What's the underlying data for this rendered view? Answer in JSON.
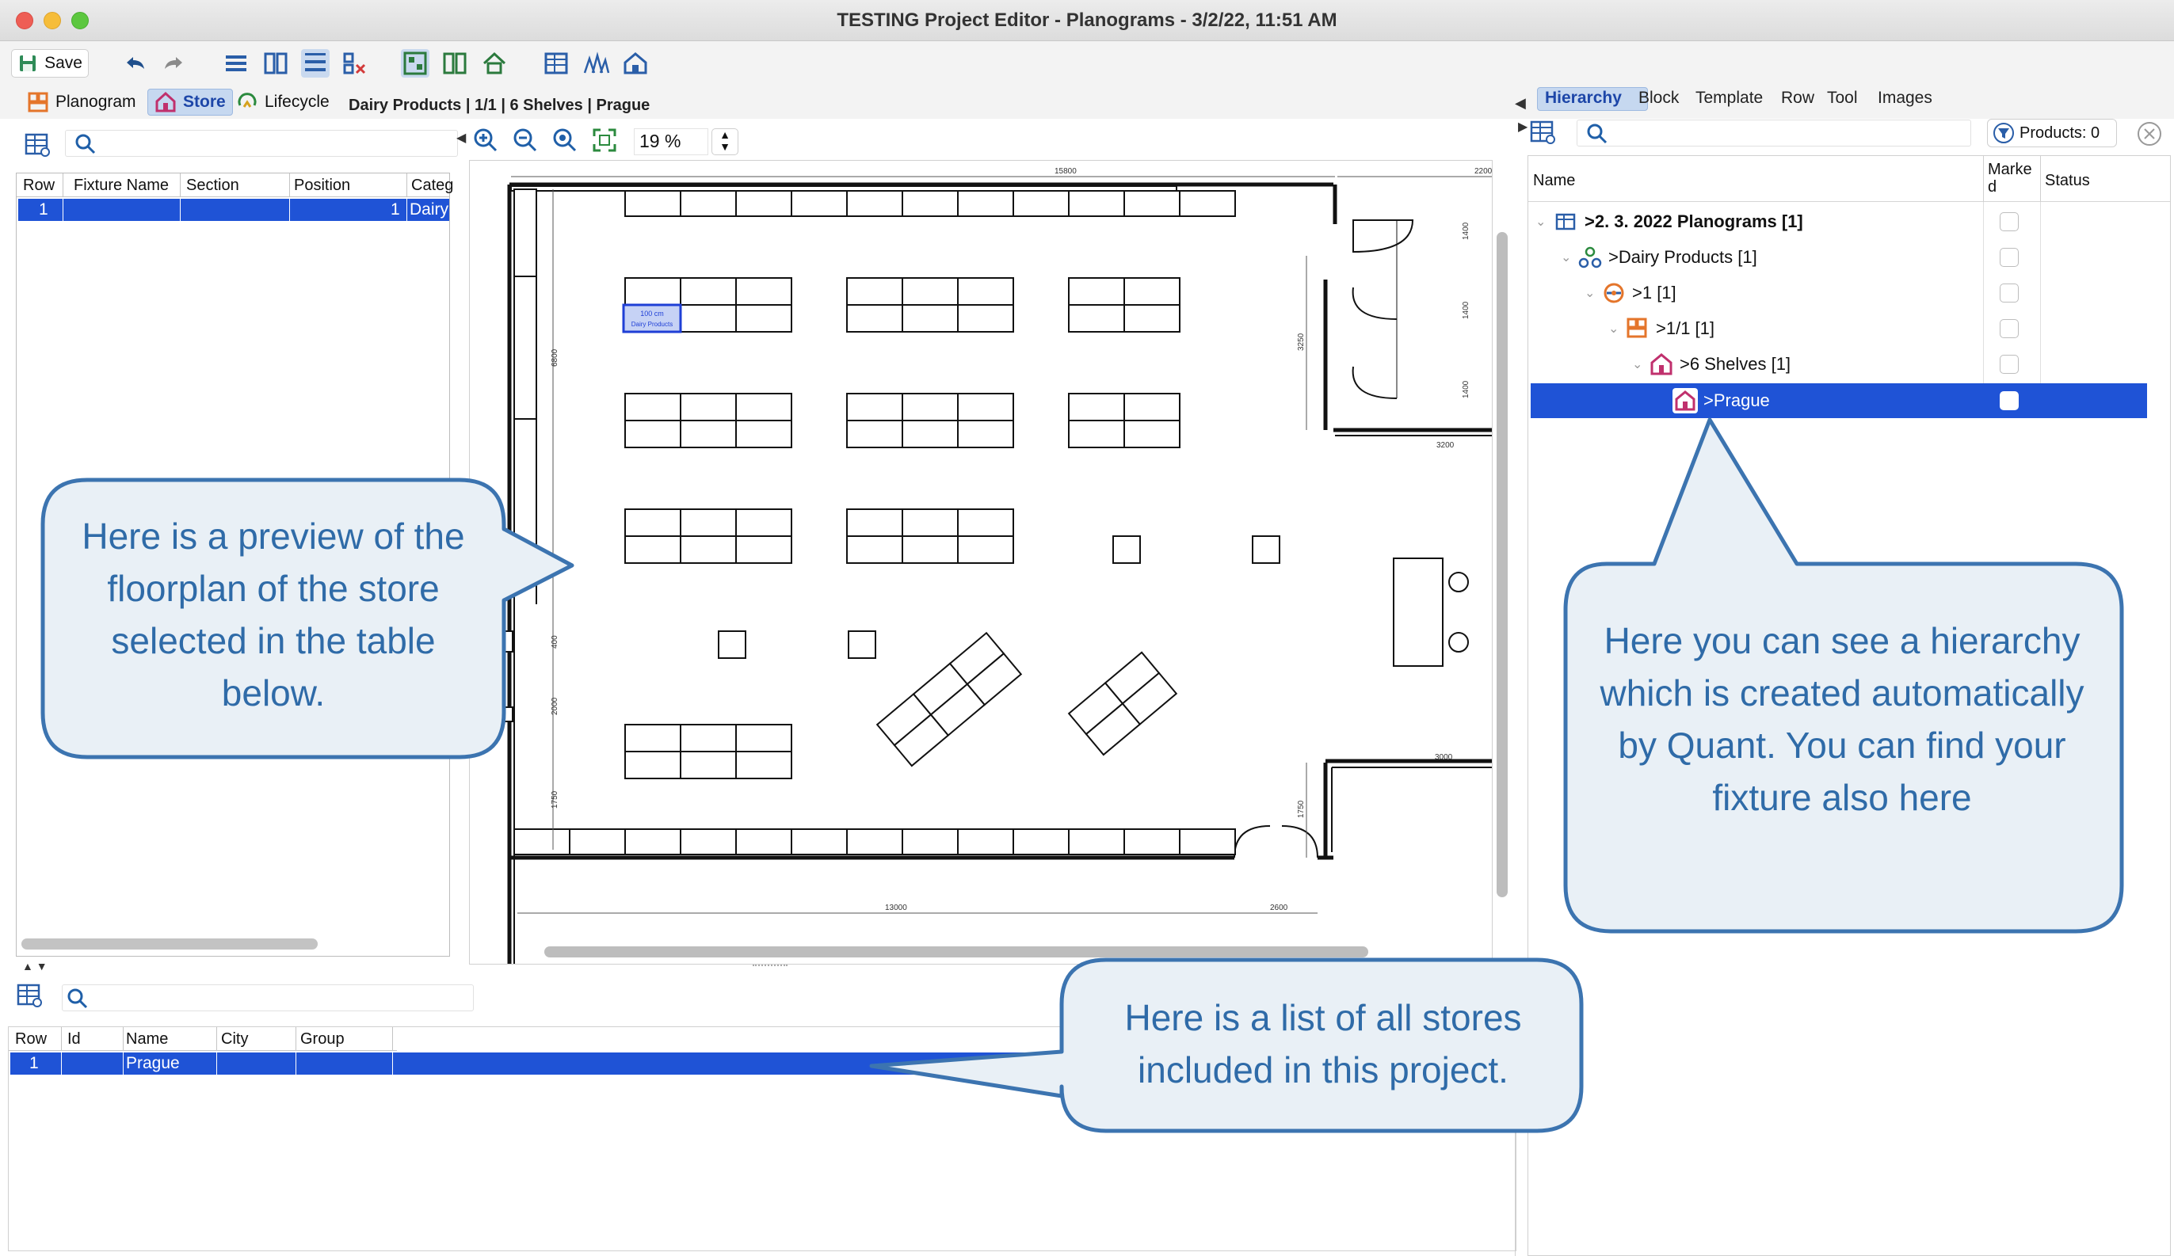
{
  "window": {
    "title": "TESTING Project Editor - Planograms - 3/2/22, 11:51 AM"
  },
  "toolbar": {
    "save_label": "Save"
  },
  "nav_tabs": {
    "planogram": "Planogram",
    "store": "Store",
    "lifecycle": "Lifecycle"
  },
  "breadcrumb": {
    "text": "Dairy Products | 1/1 | 6 Shelves | Prague"
  },
  "zoom": {
    "value": "19 %"
  },
  "fixture_table": {
    "headers": [
      "Row",
      "Fixture Name",
      "Section",
      "Position",
      "Categ"
    ],
    "row": {
      "row": "1",
      "fixture_name": "",
      "section": "",
      "position": "1",
      "category": "Dairy"
    }
  },
  "floorplan": {
    "dim_top": "15800",
    "dim_top_right": "2200",
    "dim_bottom": "13000",
    "dim_bottom_door": "2600",
    "dim_right_bottom": "3000",
    "dim_right_top": "3200",
    "dim_left_1": "6800",
    "dim_left_2": "400",
    "dim_left_3": "2000",
    "dim_left_4": "1750",
    "dim_right_v1": "3250",
    "dim_right_v2": "1750",
    "dim_door_1": "1400",
    "dim_door_2": "1400",
    "dim_door_3": "1400",
    "selected_fixture_line1": "100 cm",
    "selected_fixture_line2": "Dairy Products"
  },
  "hierarchy_tabs": [
    "Hierarchy",
    "Block",
    "Template",
    "Row",
    "Tool",
    "Images"
  ],
  "products_filter": "Products: 0",
  "hierarchy_headers": {
    "name": "Name",
    "marked": "Marked",
    "status": "Status"
  },
  "hierarchy_items": [
    {
      "label": ">2. 3. 2022 Planograms [1]",
      "bold": true
    },
    {
      "label": ">Dairy Products [1]"
    },
    {
      "label": ">1 [1]"
    },
    {
      "label": ">1/1 [1]"
    },
    {
      "label": ">6 Shelves [1]"
    },
    {
      "label": ">Prague"
    }
  ],
  "store_table": {
    "headers": [
      "Row",
      "Id",
      "Name",
      "City",
      "Group"
    ],
    "row": {
      "row": "1",
      "id": "",
      "name": "Prague",
      "city": "",
      "group": ""
    }
  },
  "callouts": {
    "floorplan": "Here is a preview of the floorplan of the store selected in the table below.",
    "hierarchy": "Here you can see a hierarchy which is created automatically by Quant. You can find your fixture also here",
    "stores": "Here is a list of all stores included in this project."
  },
  "colors": {
    "selection": "#1f53d6",
    "callout_border": "#3c74b0",
    "callout_fill": "#e9f0f6",
    "callout_text": "#2f6ba8"
  }
}
